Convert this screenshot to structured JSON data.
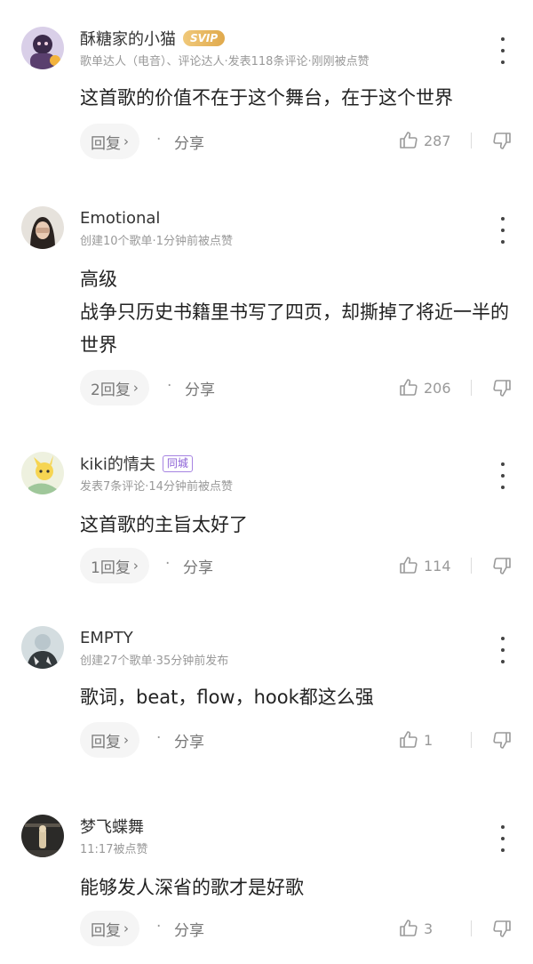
{
  "comments": [
    {
      "username": "酥糖家的小猫",
      "badge": "SVIP",
      "meta": "歌单达人（电音）、评论达人·发表118条评论·刚刚被点赞",
      "content": [
        "这首歌的价值不在于这个舞台，在于这个世界"
      ],
      "reply_label": "回复",
      "chevron": "›",
      "separator": "·",
      "share_label": "分享",
      "likes": "287"
    },
    {
      "username": "Emotional",
      "meta": "创建10个歌单·1分钟前被点赞",
      "content": [
        "高级",
        "战争只历史书籍里书写了四页，却撕掉了将近一半的世界"
      ],
      "reply_label": "2回复",
      "chevron": "›",
      "separator": "·",
      "share_label": "分享",
      "likes": "206"
    },
    {
      "username": "kiki的情夫",
      "badge": "同城",
      "meta": "发表7条评论·14分钟前被点赞",
      "content": [
        "这首歌的主旨太好了"
      ],
      "reply_label": "1回复",
      "chevron": "›",
      "separator": "·",
      "share_label": "分享",
      "likes": "114"
    },
    {
      "username": "EMPTY",
      "meta": "创建27个歌单·35分钟前发布",
      "content": [
        "歌词，beat，flow，hook都这么强"
      ],
      "reply_label": "回复",
      "chevron": "›",
      "separator": "·",
      "share_label": "分享",
      "likes": "1"
    },
    {
      "username": "梦飞蝶舞",
      "meta": "11:17被点赞",
      "content": [
        "能够发人深省的歌才是好歌"
      ],
      "reply_label": "回复",
      "chevron": "›",
      "separator": "·",
      "share_label": "分享",
      "likes": "3"
    }
  ],
  "icons": {
    "more": "more-vertical-icon",
    "like": "thumbs-up-icon",
    "dislike": "thumbs-down-icon"
  },
  "colors": {
    "svip_badge": "#e0a94c",
    "city_badge": "#8b5fd6",
    "secondary_text": "#999999"
  }
}
